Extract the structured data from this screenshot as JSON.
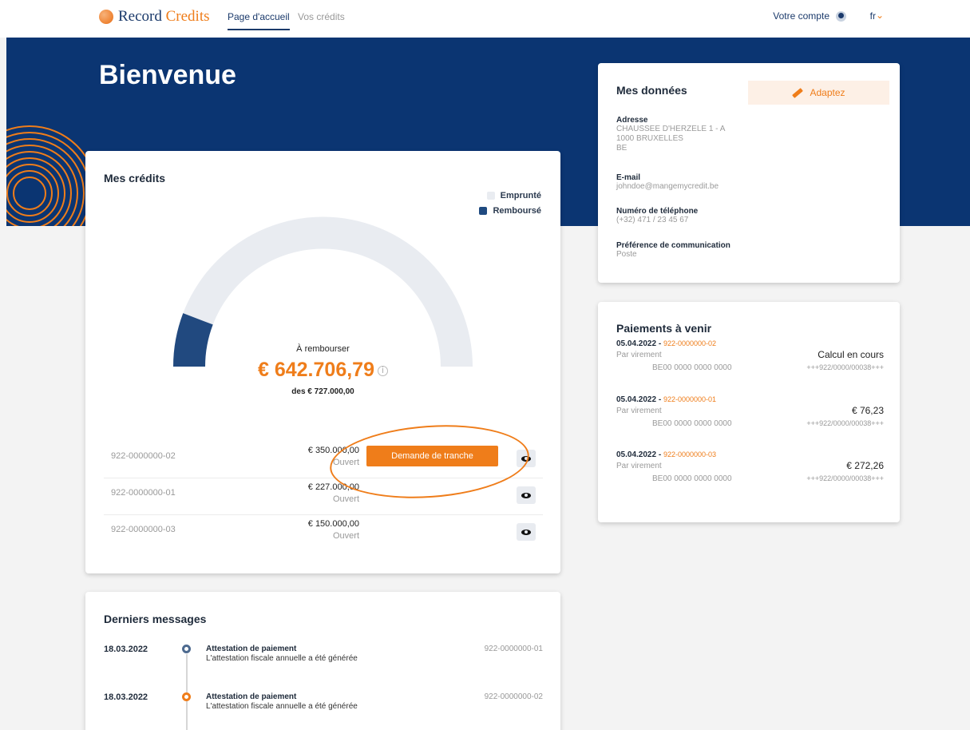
{
  "nav": {
    "logo_part1": "Record",
    "logo_part2": "Credits",
    "home": "Page d'accueil",
    "credits": "Vos crédits",
    "account": "Votre compte",
    "lang": "fr"
  },
  "hero": {
    "title": "Bienvenue"
  },
  "credits": {
    "title": "Mes crédits",
    "legend": [
      {
        "label": "Emprunté",
        "color": "#e9ecf1"
      },
      {
        "label": "Remboursé",
        "color": "#1f4a80"
      }
    ],
    "label_remaining": "À rembourser",
    "amount": "€ 642.706,79",
    "info": "i",
    "of_total": "des € 727.000,00",
    "repaid_fraction": 0.116,
    "tranche_button": "Demande de tranche",
    "rows": [
      {
        "ref": "922-0000000-02",
        "amount": "€ 350.000,00",
        "status": "Ouvert"
      },
      {
        "ref": "922-0000000-01",
        "amount": "€ 227.000,00",
        "status": "Ouvert"
      },
      {
        "ref": "922-0000000-03",
        "amount": "€ 150.000,00",
        "status": "Ouvert"
      }
    ]
  },
  "donnees": {
    "title": "Mes données",
    "adapt": "Adaptez",
    "address_label": "Adresse",
    "address_l1": "CHAUSSEE D'HERZELE 1 - A",
    "address_l2": "1000 BRUXELLES",
    "address_l3": "BE",
    "email_label": "E-mail",
    "email": "johndoe@mangemycredit.be",
    "phone_label": "Numéro de téléphone",
    "phone": "(+32) 471 / 23 45 67",
    "pref_label": "Préférence de communication",
    "pref": "Poste"
  },
  "paiements": {
    "title": "Paiements à venir",
    "items": [
      {
        "date": "05.04.2022",
        "ref": "922-0000000-02",
        "method": "Par virement",
        "iban": "BE00 0000 0000 0000",
        "value": "Calcul en cours",
        "comm": "+++922/0000/00038+++"
      },
      {
        "date": "05.04.2022",
        "ref": "922-0000000-01",
        "method": "Par virement",
        "iban": "BE00 0000 0000 0000",
        "value": "€ 76,23",
        "comm": "+++922/0000/00038+++"
      },
      {
        "date": "05.04.2022",
        "ref": "922-0000000-03",
        "method": "Par virement",
        "iban": "BE00 0000 0000 0000",
        "value": "€ 272,26",
        "comm": "+++922/0000/00038+++"
      }
    ]
  },
  "messages": {
    "title": "Derniers messages",
    "items": [
      {
        "date": "18.03.2022",
        "title": "Attestation de paiement",
        "sub": "L'attestation fiscale annuelle a été générée",
        "ref": "922-0000000-01"
      },
      {
        "date": "18.03.2022",
        "title": "Attestation de paiement",
        "sub": "L'attestation fiscale annuelle a été générée",
        "ref": "922-0000000-02"
      }
    ]
  }
}
